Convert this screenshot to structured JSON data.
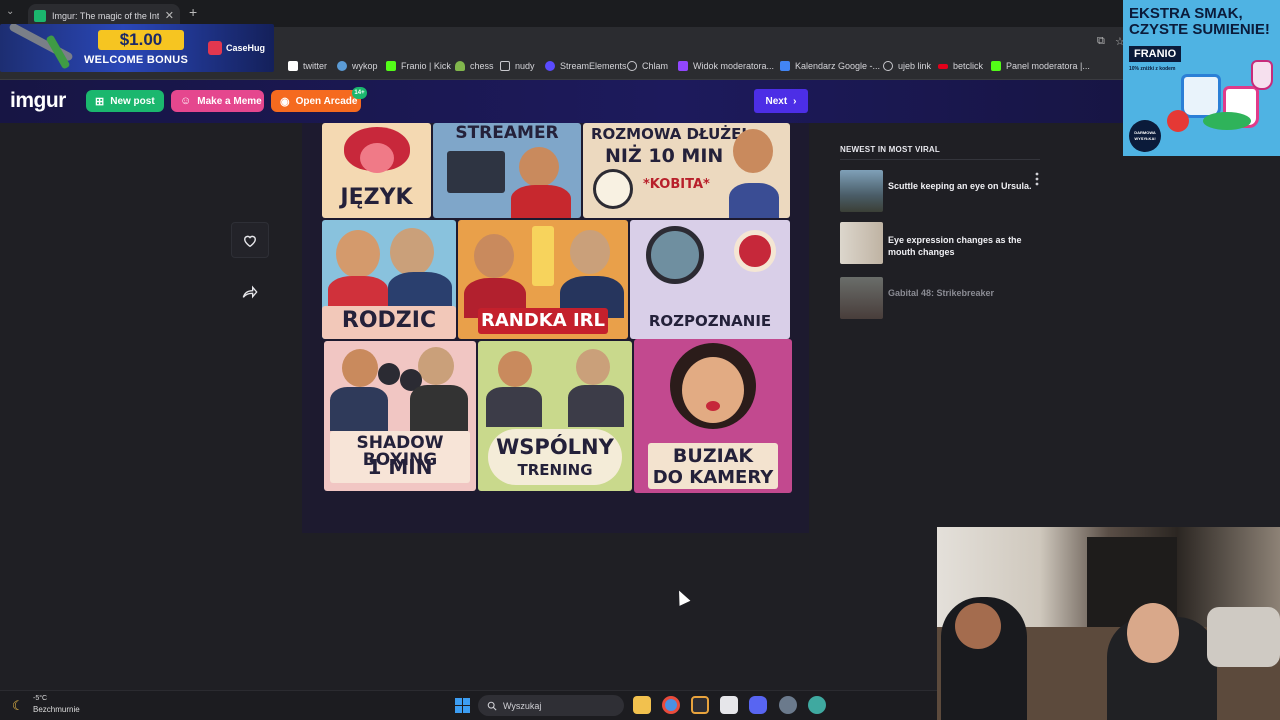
{
  "browser": {
    "tab_title": "Imgur: The magic of the Interne",
    "tab_list_icon": "chevron-down-icon",
    "new_tab_icon": "plus-icon",
    "close_icon": "close-icon",
    "bookmarks": [
      {
        "label": "twitter",
        "icon": "x-icon",
        "color": "#ffffff"
      },
      {
        "label": "wykop",
        "icon": "wykop-icon",
        "color": "#5b9bd5"
      },
      {
        "label": "Franio | Kick",
        "icon": "kick-icon",
        "color": "#53fc18"
      },
      {
        "label": "chess",
        "icon": "chess-icon",
        "color": "#81b64c"
      },
      {
        "label": "nudy",
        "icon": "folder-icon",
        "color": "#c7c7cc"
      },
      {
        "label": "StreamElements",
        "icon": "streamelements-icon",
        "color": "#5a4bff"
      },
      {
        "label": "Chlam",
        "icon": "globe-icon",
        "color": "#c7c7cc"
      },
      {
        "label": "Widok moderatora...",
        "icon": "twitch-icon",
        "color": "#9146ff"
      },
      {
        "label": "Kalendarz Google -...",
        "icon": "calendar-icon",
        "color": "#4285f4"
      },
      {
        "label": "ujeb link",
        "icon": "globe-icon",
        "color": "#c7c7cc"
      },
      {
        "label": "betclick",
        "icon": "betclick-icon",
        "color": "#e2001a"
      },
      {
        "label": "Panel moderatora |...",
        "icon": "kick-icon",
        "color": "#53fc18"
      }
    ]
  },
  "ads": {
    "top_left": {
      "amount": "$1.00",
      "bonus": "WELCOME BONUS",
      "brand": "CaseHug"
    },
    "right": {
      "title": "EKSTRA SMAK, CZYSTE SUMIENIE!",
      "brand": "FRANIO",
      "sub": "10% zniżki z kodem",
      "badge": "DARMOWA WYSYŁKA!"
    }
  },
  "header": {
    "logo": "imgur",
    "new_post": "New post",
    "make_meme": "Make a Meme",
    "open_arcade": "Open Arcade",
    "arcade_badge": "14+",
    "next": "Next"
  },
  "post": {
    "panels": [
      {
        "label": "JĘZYK"
      },
      {
        "label": "STREAMER"
      },
      {
        "label_line1": "ROZMOWA DŁUŻEJ",
        "label_line2": "NIŻ 10 MIN",
        "label_line3": "*KOBITA*"
      },
      {
        "label": "RODZIC"
      },
      {
        "label": "RANDKA IRL"
      },
      {
        "label": "ROZPOZNANIE"
      },
      {
        "label_line1": "SHADOW BOXING",
        "label_line2": "1 MIN"
      },
      {
        "label_line1": "WSPÓLNY",
        "label_line2": "TRENING"
      },
      {
        "label_line1": "BUZIAK",
        "label_line2": "DO KAMERY"
      }
    ]
  },
  "sidebar": {
    "title": "NEWEST IN MOST VIRAL",
    "items": [
      {
        "title": "Scuttle keeping an eye on Ursula."
      },
      {
        "title": "Eye expression changes as the mouth changes"
      },
      {
        "title": "Gabital 48: Strikebreaker"
      }
    ]
  },
  "taskbar": {
    "temperature": "-5°C",
    "weather": "Bezchmurnie",
    "search_placeholder": "Wyszukaj"
  }
}
